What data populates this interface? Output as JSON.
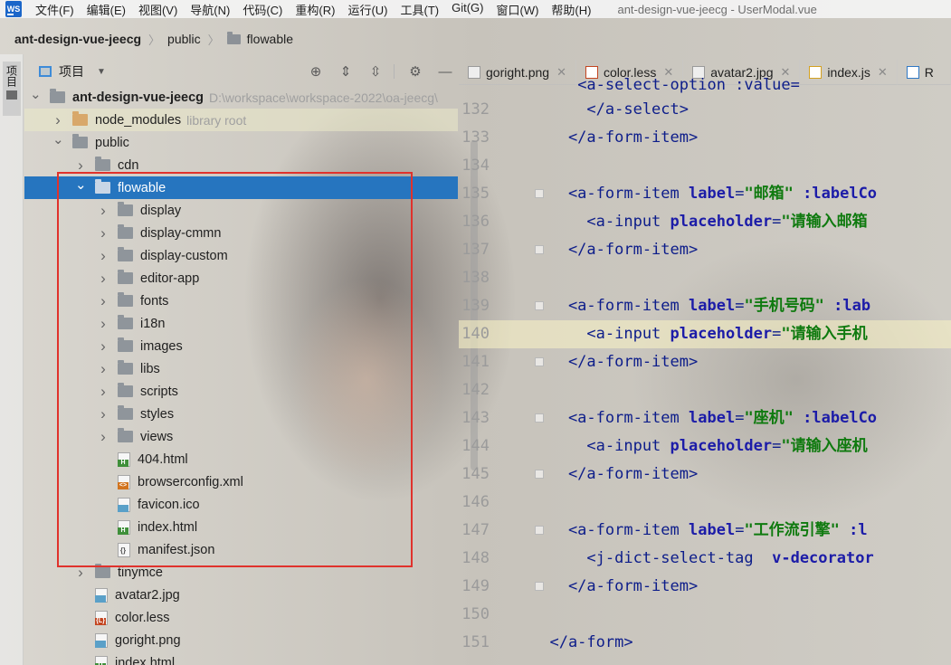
{
  "menubar": {
    "items": [
      "文件(F)",
      "编辑(E)",
      "视图(V)",
      "导航(N)",
      "代码(C)",
      "重构(R)",
      "运行(U)",
      "工具(T)",
      "Git(G)",
      "窗口(W)",
      "帮助(H)"
    ],
    "window_title": "ant-design-vue-jeecg - UserModal.vue"
  },
  "breadcrumb": [
    "ant-design-vue-jeecg",
    "public",
    "flowable"
  ],
  "toolstrip": {
    "label": "项目"
  },
  "panel": {
    "title": "项目",
    "tree": [
      {
        "label": "ant-design-vue-jeecg",
        "secondary": "D:\\workspace\\workspace-2022\\oa-jeecg\\",
        "depth": 0,
        "expanded": true,
        "kind": "folder",
        "bold": true
      },
      {
        "label": "node_modules",
        "secondary": "library root",
        "depth": 1,
        "expanded": false,
        "kind": "folder-orange"
      },
      {
        "label": "public",
        "secondary": "",
        "depth": 1,
        "expanded": true,
        "kind": "folder"
      },
      {
        "label": "cdn",
        "secondary": "",
        "depth": 2,
        "expanded": false,
        "kind": "folder"
      },
      {
        "label": "flowable",
        "secondary": "",
        "depth": 2,
        "expanded": true,
        "kind": "folder",
        "selected": true
      },
      {
        "label": "display",
        "secondary": "",
        "depth": 3,
        "expanded": false,
        "kind": "folder"
      },
      {
        "label": "display-cmmn",
        "secondary": "",
        "depth": 3,
        "expanded": false,
        "kind": "folder"
      },
      {
        "label": "display-custom",
        "secondary": "",
        "depth": 3,
        "expanded": false,
        "kind": "folder"
      },
      {
        "label": "editor-app",
        "secondary": "",
        "depth": 3,
        "expanded": false,
        "kind": "folder"
      },
      {
        "label": "fonts",
        "secondary": "",
        "depth": 3,
        "expanded": false,
        "kind": "folder"
      },
      {
        "label": "i18n",
        "secondary": "",
        "depth": 3,
        "expanded": false,
        "kind": "folder"
      },
      {
        "label": "images",
        "secondary": "",
        "depth": 3,
        "expanded": false,
        "kind": "folder"
      },
      {
        "label": "libs",
        "secondary": "",
        "depth": 3,
        "expanded": false,
        "kind": "folder"
      },
      {
        "label": "scripts",
        "secondary": "",
        "depth": 3,
        "expanded": false,
        "kind": "folder"
      },
      {
        "label": "styles",
        "secondary": "",
        "depth": 3,
        "expanded": false,
        "kind": "folder"
      },
      {
        "label": "views",
        "secondary": "",
        "depth": 3,
        "expanded": false,
        "kind": "folder"
      },
      {
        "label": "404.html",
        "secondary": "",
        "depth": 3,
        "kind": "html"
      },
      {
        "label": "browserconfig.xml",
        "secondary": "",
        "depth": 3,
        "kind": "xml"
      },
      {
        "label": "favicon.ico",
        "secondary": "",
        "depth": 3,
        "kind": "img"
      },
      {
        "label": "index.html",
        "secondary": "",
        "depth": 3,
        "kind": "html"
      },
      {
        "label": "manifest.json",
        "secondary": "",
        "depth": 3,
        "kind": "json"
      },
      {
        "label": "tinymce",
        "secondary": "",
        "depth": 2,
        "expanded": false,
        "kind": "folder"
      },
      {
        "label": "avatar2.jpg",
        "secondary": "",
        "depth": 2,
        "kind": "img"
      },
      {
        "label": "color.less",
        "secondary": "",
        "depth": 2,
        "kind": "less"
      },
      {
        "label": "goright.png",
        "secondary": "",
        "depth": 2,
        "kind": "img"
      },
      {
        "label": "index.html",
        "secondary": "",
        "depth": 2,
        "kind": "html"
      }
    ]
  },
  "editor": {
    "tabs": [
      {
        "label": "goright.png",
        "icon": "image-file-icon"
      },
      {
        "label": "color.less",
        "icon": "less-file-icon"
      },
      {
        "label": "avatar2.jpg",
        "icon": "image-file-icon"
      },
      {
        "label": "index.js",
        "icon": "js-file-icon"
      },
      {
        "label": "R",
        "icon": "md-file-icon"
      }
    ],
    "current_line": 140,
    "lines": [
      {
        "n": 132,
        "parts": [
          [
            "tag",
            "      </a-select>"
          ]
        ]
      },
      {
        "n": 133,
        "parts": [
          [
            "tag",
            "    </a-form-item>"
          ]
        ]
      },
      {
        "n": 134,
        "parts": []
      },
      {
        "n": 135,
        "parts": [
          [
            "tag",
            "    <a-form-item "
          ],
          [
            "attr",
            "label"
          ],
          [
            "eq",
            "="
          ],
          [
            "str",
            "\"邮箱\""
          ],
          [
            "attr",
            " :labelCo"
          ]
        ]
      },
      {
        "n": 136,
        "parts": [
          [
            "tag",
            "      <a-input "
          ],
          [
            "attr",
            "placeholder"
          ],
          [
            "eq",
            "="
          ],
          [
            "str",
            "\"请输入邮箱"
          ]
        ]
      },
      {
        "n": 137,
        "parts": [
          [
            "tag",
            "    </a-form-item>"
          ]
        ]
      },
      {
        "n": 138,
        "parts": []
      },
      {
        "n": 139,
        "parts": [
          [
            "tag",
            "    <a-form-item "
          ],
          [
            "attr",
            "label"
          ],
          [
            "eq",
            "="
          ],
          [
            "str",
            "\"手机号码\""
          ],
          [
            "attr",
            " :lab"
          ]
        ]
      },
      {
        "n": 140,
        "parts": [
          [
            "tag",
            "      <a-input "
          ],
          [
            "attr",
            "placeholder"
          ],
          [
            "eq",
            "="
          ],
          [
            "str",
            "\"请输入手机"
          ]
        ]
      },
      {
        "n": 141,
        "parts": [
          [
            "tag",
            "    </a-form-item>"
          ]
        ]
      },
      {
        "n": 142,
        "parts": []
      },
      {
        "n": 143,
        "parts": [
          [
            "tag",
            "    <a-form-item "
          ],
          [
            "attr",
            "label"
          ],
          [
            "eq",
            "="
          ],
          [
            "str",
            "\"座机\""
          ],
          [
            "attr",
            " :labelCo"
          ]
        ]
      },
      {
        "n": 144,
        "parts": [
          [
            "tag",
            "      <a-input "
          ],
          [
            "attr",
            "placeholder"
          ],
          [
            "eq",
            "="
          ],
          [
            "str",
            "\"请输入座机"
          ]
        ]
      },
      {
        "n": 145,
        "parts": [
          [
            "tag",
            "    </a-form-item>"
          ]
        ]
      },
      {
        "n": 146,
        "parts": []
      },
      {
        "n": 147,
        "parts": [
          [
            "tag",
            "    <a-form-item "
          ],
          [
            "attr",
            "label"
          ],
          [
            "eq",
            "="
          ],
          [
            "str",
            "\"工作流引擎\""
          ],
          [
            "attr",
            " :l"
          ]
        ]
      },
      {
        "n": 148,
        "parts": [
          [
            "tag",
            "      <j-dict-select-tag  "
          ],
          [
            "attr",
            "v-decorator"
          ]
        ]
      },
      {
        "n": 149,
        "parts": [
          [
            "tag",
            "    </a-form-item>"
          ]
        ]
      },
      {
        "n": 150,
        "parts": []
      },
      {
        "n": 151,
        "parts": [
          [
            "tag",
            "  </a-form>"
          ]
        ]
      }
    ]
  }
}
